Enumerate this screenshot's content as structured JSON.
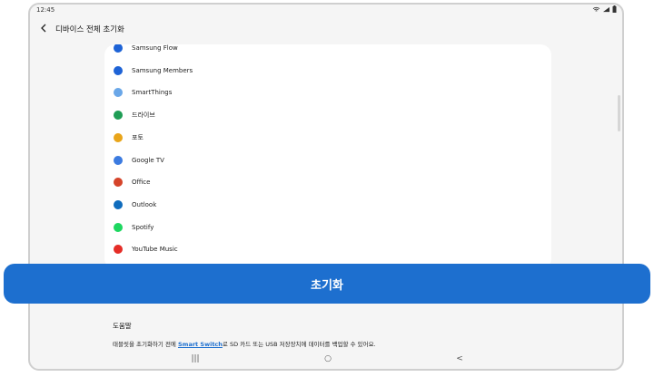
{
  "status": {
    "time": "12:45"
  },
  "header": {
    "title": "디바이스 전체 초기화"
  },
  "apps": [
    {
      "label": "Samsung Flow",
      "icon": "samsung-flow-icon",
      "color": "#1e63d6"
    },
    {
      "label": "Samsung Members",
      "icon": "samsung-members-icon",
      "color": "#1e63d6"
    },
    {
      "label": "SmartThings",
      "icon": "smartthings-icon",
      "color": "#6aa7e8"
    },
    {
      "label": "드라이브",
      "icon": "drive-icon",
      "color": "#1f9d55"
    },
    {
      "label": "포토",
      "icon": "photos-icon",
      "color": "#e9a51a"
    },
    {
      "label": "Google TV",
      "icon": "google-tv-icon",
      "color": "#3c7be0"
    },
    {
      "label": "Office",
      "icon": "office-icon",
      "color": "#d5442a"
    },
    {
      "label": "Outlook",
      "icon": "outlook-icon",
      "color": "#0f6cbd"
    },
    {
      "label": "Spotify",
      "icon": "spotify-icon",
      "color": "#1ed760"
    },
    {
      "label": "YouTube Music",
      "icon": "youtube-music-icon",
      "color": "#e52d27"
    }
  ],
  "reset_button": {
    "label": "초기화"
  },
  "help": {
    "title": "도움말",
    "text_before": "태블릿을 초기화하기 전에 ",
    "link": "Smart Switch",
    "text_after": "로 SD 카드 또는 USB 저장장치에 데이터를 백업할 수 있어요."
  },
  "nav": {
    "recents": "|||",
    "home": "○",
    "back": "<"
  }
}
